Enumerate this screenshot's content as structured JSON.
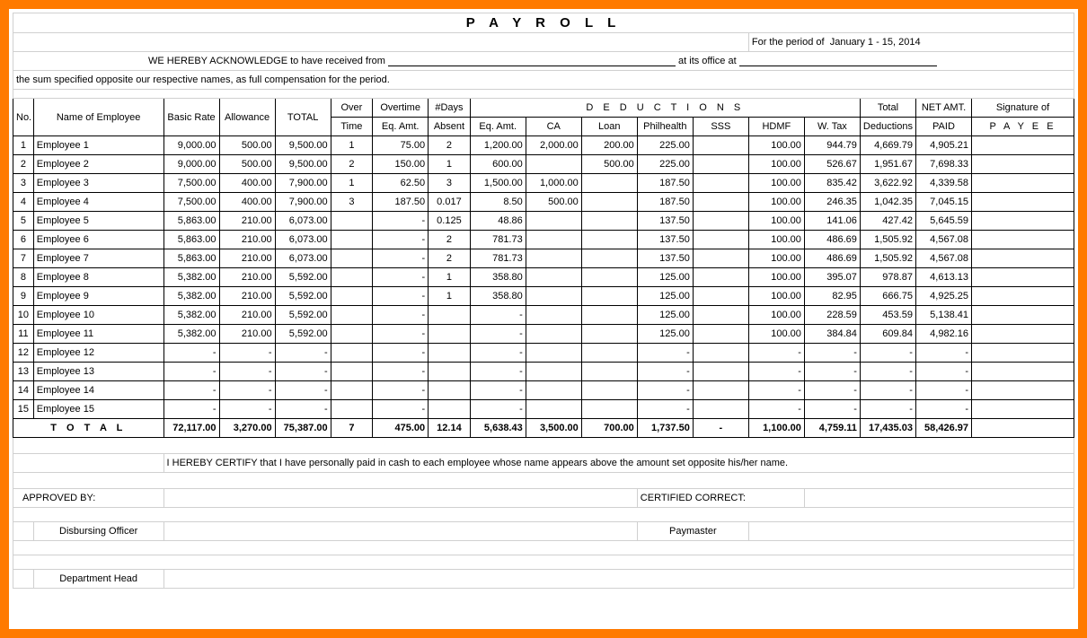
{
  "title": "P A Y R O L L",
  "period_prefix": "For the period of",
  "period": "January 1 - 15,  2014",
  "ack_line_1a": "WE HEREBY ACKNOWLEDGE to have received from",
  "ack_line_1b": "at its office at",
  "ack_line_2": "the sum specified opposite our respective names, as full compensation for the period.",
  "headers": {
    "no": "No.",
    "name": "Name of Employee",
    "basic": "Basic Rate",
    "allowance": "Allowance",
    "total": "TOTAL",
    "over": "Over",
    "time": "Time",
    "overtime": "Overtime",
    "eqamt": "Eq. Amt.",
    "days": "#Days",
    "absent": "Absent",
    "deductions": "D E D U C T I O N S",
    "ded_eqamt": "Eq. Amt.",
    "ca": "CA",
    "loan": "Loan",
    "philhealth": "Philhealth",
    "sss": "SSS",
    "hdmf": "HDMF",
    "wtax": "W. Tax",
    "total_ded_1": "Total",
    "total_ded_2": "Deductions",
    "netamt_1": "NET AMT.",
    "netamt_2": "PAID",
    "sig_1": "Signature of",
    "sig_2": "P A Y E E"
  },
  "rows": [
    {
      "no": "1",
      "name": "Employee 1",
      "basic": "9,000.00",
      "allow": "500.00",
      "total": "9,500.00",
      "ot": "1",
      "oteq": "75.00",
      "days": "2",
      "abseq": "1,200.00",
      "ca": "2,000.00",
      "loan": "200.00",
      "ph": "225.00",
      "sss": "",
      "hdmf": "100.00",
      "wtax": "944.79",
      "ded": "4,669.79",
      "net": "4,905.21"
    },
    {
      "no": "2",
      "name": "Employee 2",
      "basic": "9,000.00",
      "allow": "500.00",
      "total": "9,500.00",
      "ot": "2",
      "oteq": "150.00",
      "days": "1",
      "abseq": "600.00",
      "ca": "",
      "loan": "500.00",
      "ph": "225.00",
      "sss": "",
      "hdmf": "100.00",
      "wtax": "526.67",
      "ded": "1,951.67",
      "net": "7,698.33"
    },
    {
      "no": "3",
      "name": "Employee 3",
      "basic": "7,500.00",
      "allow": "400.00",
      "total": "7,900.00",
      "ot": "1",
      "oteq": "62.50",
      "days": "3",
      "abseq": "1,500.00",
      "ca": "1,000.00",
      "loan": "",
      "ph": "187.50",
      "sss": "",
      "hdmf": "100.00",
      "wtax": "835.42",
      "ded": "3,622.92",
      "net": "4,339.58"
    },
    {
      "no": "4",
      "name": "Employee 4",
      "basic": "7,500.00",
      "allow": "400.00",
      "total": "7,900.00",
      "ot": "3",
      "oteq": "187.50",
      "days": "0.017",
      "abseq": "8.50",
      "ca": "500.00",
      "loan": "",
      "ph": "187.50",
      "sss": "",
      "hdmf": "100.00",
      "wtax": "246.35",
      "ded": "1,042.35",
      "net": "7,045.15"
    },
    {
      "no": "5",
      "name": "Employee 5",
      "basic": "5,863.00",
      "allow": "210.00",
      "total": "6,073.00",
      "ot": "",
      "oteq": "-",
      "days": "0.125",
      "abseq": "48.86",
      "ca": "",
      "loan": "",
      "ph": "137.50",
      "sss": "",
      "hdmf": "100.00",
      "wtax": "141.06",
      "ded": "427.42",
      "net": "5,645.59"
    },
    {
      "no": "6",
      "name": "Employee 6",
      "basic": "5,863.00",
      "allow": "210.00",
      "total": "6,073.00",
      "ot": "",
      "oteq": "-",
      "days": "2",
      "abseq": "781.73",
      "ca": "",
      "loan": "",
      "ph": "137.50",
      "sss": "",
      "hdmf": "100.00",
      "wtax": "486.69",
      "ded": "1,505.92",
      "net": "4,567.08"
    },
    {
      "no": "7",
      "name": "Employee 7",
      "basic": "5,863.00",
      "allow": "210.00",
      "total": "6,073.00",
      "ot": "",
      "oteq": "-",
      "days": "2",
      "abseq": "781.73",
      "ca": "",
      "loan": "",
      "ph": "137.50",
      "sss": "",
      "hdmf": "100.00",
      "wtax": "486.69",
      "ded": "1,505.92",
      "net": "4,567.08"
    },
    {
      "no": "8",
      "name": "Employee 8",
      "basic": "5,382.00",
      "allow": "210.00",
      "total": "5,592.00",
      "ot": "",
      "oteq": "-",
      "days": "1",
      "abseq": "358.80",
      "ca": "",
      "loan": "",
      "ph": "125.00",
      "sss": "",
      "hdmf": "100.00",
      "wtax": "395.07",
      "ded": "978.87",
      "net": "4,613.13"
    },
    {
      "no": "9",
      "name": "Employee 9",
      "basic": "5,382.00",
      "allow": "210.00",
      "total": "5,592.00",
      "ot": "",
      "oteq": "-",
      "days": "1",
      "abseq": "358.80",
      "ca": "",
      "loan": "",
      "ph": "125.00",
      "sss": "",
      "hdmf": "100.00",
      "wtax": "82.95",
      "ded": "666.75",
      "net": "4,925.25"
    },
    {
      "no": "10",
      "name": "Employee 10",
      "basic": "5,382.00",
      "allow": "210.00",
      "total": "5,592.00",
      "ot": "",
      "oteq": "-",
      "days": "",
      "abseq": "-",
      "ca": "",
      "loan": "",
      "ph": "125.00",
      "sss": "",
      "hdmf": "100.00",
      "wtax": "228.59",
      "ded": "453.59",
      "net": "5,138.41"
    },
    {
      "no": "11",
      "name": "Employee 11",
      "basic": "5,382.00",
      "allow": "210.00",
      "total": "5,592.00",
      "ot": "",
      "oteq": "-",
      "days": "",
      "abseq": "-",
      "ca": "",
      "loan": "",
      "ph": "125.00",
      "sss": "",
      "hdmf": "100.00",
      "wtax": "384.84",
      "ded": "609.84",
      "net": "4,982.16"
    },
    {
      "no": "12",
      "name": "Employee 12",
      "basic": "-",
      "allow": "-",
      "total": "-",
      "ot": "",
      "oteq": "-",
      "days": "",
      "abseq": "-",
      "ca": "",
      "loan": "",
      "ph": "-",
      "sss": "",
      "hdmf": "-",
      "wtax": "-",
      "ded": "-",
      "net": "-"
    },
    {
      "no": "13",
      "name": "Employee 13",
      "basic": "-",
      "allow": "-",
      "total": "-",
      "ot": "",
      "oteq": "-",
      "days": "",
      "abseq": "-",
      "ca": "",
      "loan": "",
      "ph": "-",
      "sss": "",
      "hdmf": "-",
      "wtax": "-",
      "ded": "-",
      "net": "-"
    },
    {
      "no": "14",
      "name": "Employee 14",
      "basic": "-",
      "allow": "-",
      "total": "-",
      "ot": "",
      "oteq": "-",
      "days": "",
      "abseq": "-",
      "ca": "",
      "loan": "",
      "ph": "-",
      "sss": "",
      "hdmf": "-",
      "wtax": "-",
      "ded": "-",
      "net": "-"
    },
    {
      "no": "15",
      "name": "Employee 15",
      "basic": "-",
      "allow": "-",
      "total": "-",
      "ot": "",
      "oteq": "-",
      "days": "",
      "abseq": "-",
      "ca": "",
      "loan": "",
      "ph": "-",
      "sss": "",
      "hdmf": "-",
      "wtax": "-",
      "ded": "-",
      "net": "-"
    }
  ],
  "totals": {
    "label": "T O T A L",
    "basic": "72,117.00",
    "allow": "3,270.00",
    "total": "75,387.00",
    "ot": "7",
    "oteq": "475.00",
    "days": "12.14",
    "abseq": "5,638.43",
    "ca": "3,500.00",
    "loan": "700.00",
    "ph": "1,737.50",
    "sss": "-",
    "hdmf": "1,100.00",
    "wtax": "4,759.11",
    "ded": "17,435.03",
    "net": "58,426.97"
  },
  "certify": "I HEREBY CERTIFY  that I have personally paid in cash to each employee whose name appears above the amount set opposite his/her name.",
  "approved_by": "APPROVED BY:",
  "certified_correct": "CERTIFIED CORRECT:",
  "disbursing_officer": "Disbursing Officer",
  "paymaster": "Paymaster",
  "department_head": "Department Head"
}
